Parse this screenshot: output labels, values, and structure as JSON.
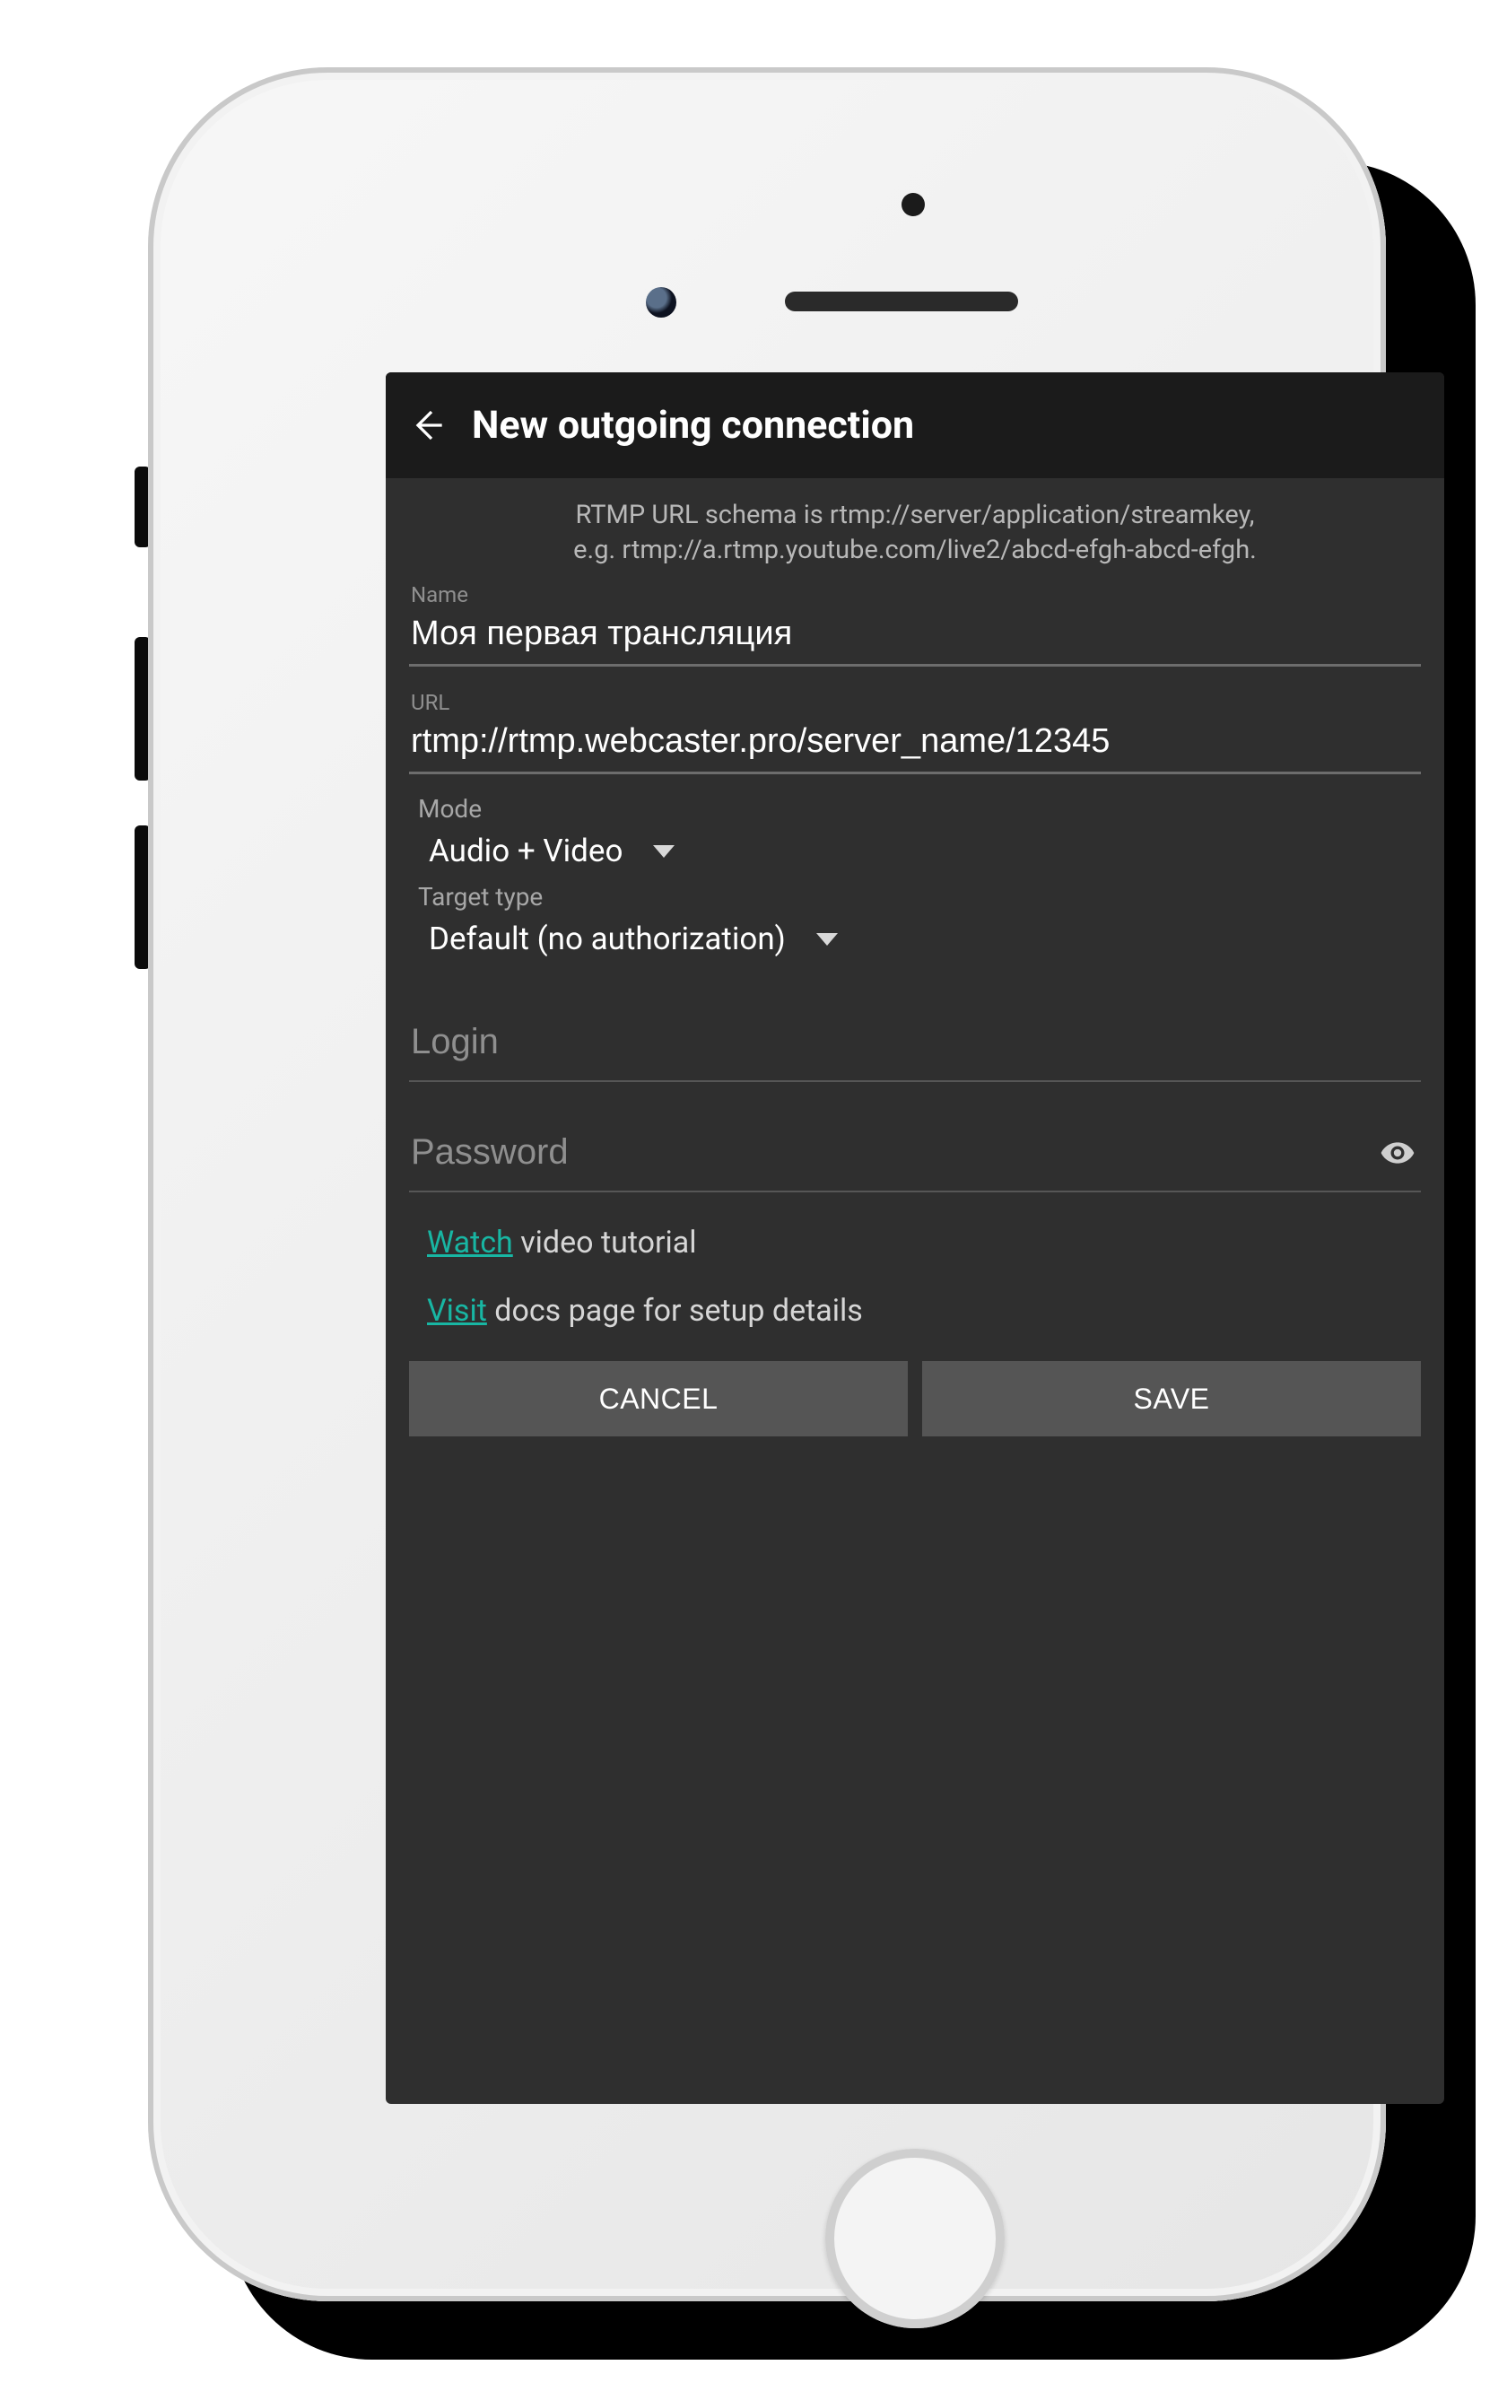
{
  "appbar": {
    "title": "New outgoing connection"
  },
  "hint": {
    "line1": "RTMP URL schema is rtmp://server/application/streamkey,",
    "line2": "e.g. rtmp://a.rtmp.youtube.com/live2/abcd-efgh-abcd-efgh."
  },
  "fields": {
    "name": {
      "label": "Name",
      "value": "Моя первая трансляция"
    },
    "url": {
      "label": "URL",
      "value": "rtmp://rtmp.webcaster.pro/server_name/12345"
    },
    "mode": {
      "label": "Mode",
      "value": "Audio + Video"
    },
    "target": {
      "label": "Target type",
      "value": "Default (no authorization)"
    },
    "login": {
      "placeholder": "Login",
      "value": ""
    },
    "password": {
      "placeholder": "Password",
      "value": ""
    }
  },
  "links": {
    "watch": {
      "link_text": "Watch",
      "rest": " video tutorial"
    },
    "visit": {
      "link_text": "Visit",
      "rest": " docs page for setup details"
    }
  },
  "buttons": {
    "cancel": "CANCEL",
    "save": "SAVE"
  },
  "colors": {
    "accent": "#18b6a3",
    "screen_bg": "#2f2f2f",
    "appbar_bg": "#1b1b1b",
    "button_bg": "#555555"
  }
}
